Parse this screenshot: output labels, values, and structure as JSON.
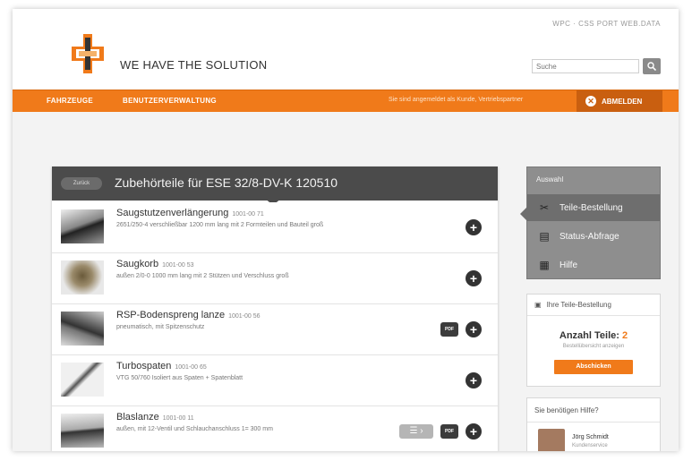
{
  "header": {
    "toplink": "WPC · CSS PORT WEB.DATA",
    "brand": "WE HAVE THE SOLUTION",
    "search_placeholder": "Suche"
  },
  "nav": {
    "items": [
      "FAHRZEUGE",
      "BENUTZERVERWALTUNG"
    ],
    "note": "Sie sind angemeldet als Kunde, Vertriebspartner",
    "logout": "ABMELDEN"
  },
  "panel": {
    "back_label": "Zurück",
    "title": "Zubehörteile für ESE 32/8-DV-K 120510",
    "items": [
      {
        "name": "Saugstutzenverlängerung",
        "number": "1001-00 71",
        "desc": "2651/250-4 verschließbar 1200 mm lang mit 2 Formteilen und Bauteil groß",
        "pdf": false,
        "list": false
      },
      {
        "name": "Saugkorb",
        "number": "1001-00 53",
        "desc": "außen 2/0-0 1000 mm lang mit 2 Stützen und Verschluss groß",
        "pdf": false,
        "list": false
      },
      {
        "name": "RSP-Bodenspreng lanze",
        "number": "1001-00 56",
        "desc": "pneumatisch, mit Spitzenschutz",
        "pdf": true,
        "list": false
      },
      {
        "name": "Turbospaten",
        "number": "1001-00 65",
        "desc": "VTG 50/760 Isoliert aus Spaten + Spatenblatt",
        "pdf": false,
        "list": false
      },
      {
        "name": "Blaslanze",
        "number": "1001-00 11",
        "desc": "außen, mit 12-Ventil und Schlauchanschluss 1= 300 mm",
        "pdf": true,
        "list": true
      }
    ],
    "pdf_label": "PDF"
  },
  "sidebar": {
    "auswahl": {
      "title": "Auswahl",
      "items": [
        {
          "label": "Teile-Bestellung",
          "active": true
        },
        {
          "label": "Status-Abfrage",
          "active": false
        },
        {
          "label": "Hilfe",
          "active": false
        }
      ]
    },
    "order": {
      "title": "Ihre Teile-Bestellung",
      "count_label": "Anzahl Teile:",
      "count": "2",
      "sub": "Bestellübersicht anzeigen",
      "button": "Abschicken"
    },
    "help": {
      "title": "Sie benötigen Hilfe?",
      "name": "Jörg Schmidt",
      "role": "Kundenservice"
    }
  },
  "colors": {
    "accent": "#f07a1a",
    "dark": "#4b4b4b"
  }
}
